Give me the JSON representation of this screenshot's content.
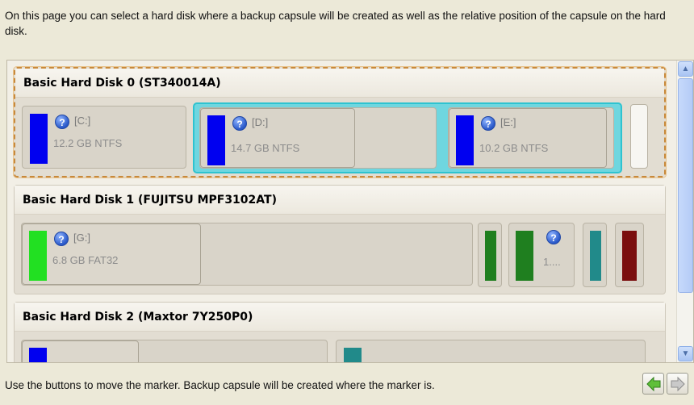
{
  "intro_text": "On this page you can select a hard disk where a backup capsule will be created as well as the relative position of the capsule on the hard disk.",
  "footer_text": "Use the buttons to move the marker. Backup capsule will be created where the marker is.",
  "disks": [
    {
      "title": "Basic Hard Disk 0 (ST340014A)",
      "partitions": [
        {
          "label": "[C:]",
          "size": "12.2 GB NTFS",
          "color": "#0000f0"
        },
        {
          "label": "[D:]",
          "size": "14.7 GB NTFS",
          "color": "#0000f0"
        },
        {
          "label": "[E:]",
          "size": "10.2 GB NTFS",
          "color": "#0000f0"
        }
      ]
    },
    {
      "title": "Basic Hard Disk 1 (FUJITSU MPF3102AT)",
      "partitions": [
        {
          "label": "[G:]",
          "size": "6.8 GB FAT32",
          "color": "#22e022"
        },
        {
          "label": "",
          "size": "",
          "color": "#1f7f1f"
        },
        {
          "label": "",
          "size": "1....",
          "color": "#1f7f1f"
        },
        {
          "label": "",
          "size": "",
          "color": "#218a8a"
        },
        {
          "label": "",
          "size": "",
          "color": "#7a0e0e"
        }
      ]
    },
    {
      "title": "Basic Hard Disk 2 (Maxtor 7Y250P0)",
      "partitions": [
        {
          "color": "#0000f0"
        },
        {
          "color": "#218a8a"
        }
      ]
    }
  ],
  "icons": {
    "help": "question-icon",
    "scroll_up": "▲",
    "scroll_down": "▼",
    "prev": "arrow-left-icon",
    "next": "arrow-right-icon"
  }
}
